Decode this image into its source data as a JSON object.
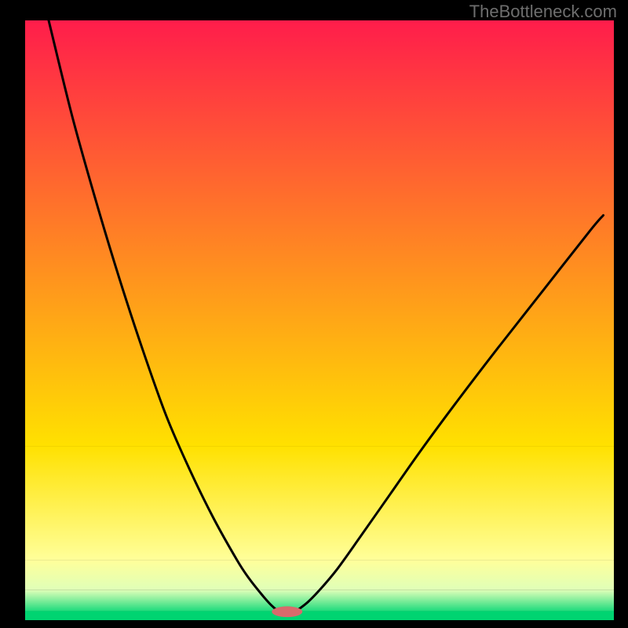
{
  "watermark": "TheBottleneck.com",
  "chart_data": {
    "type": "line",
    "title": "",
    "xlabel": "",
    "ylabel": "",
    "xlim": [
      0,
      100
    ],
    "ylim": [
      0,
      100
    ],
    "grid": false,
    "gradient_bands": [
      {
        "y0": 0.0,
        "y1": 71.0,
        "from": "#ff1d4b",
        "to": "#ffe100"
      },
      {
        "y0": 71.0,
        "y1": 90.0,
        "from": "#ffe100",
        "to": "#ffff9a"
      },
      {
        "y0": 90.0,
        "y1": 95.0,
        "from": "#ffff9a",
        "to": "#dfffb8"
      },
      {
        "y0": 95.0,
        "y1": 98.5,
        "from": "#dfffb8",
        "to": "#1edb7c"
      },
      {
        "y0": 98.5,
        "y1": 100.0,
        "color": "#00d471"
      }
    ],
    "series": [
      {
        "name": "curve-left",
        "x": [
          4,
          8,
          12,
          16,
          20,
          24,
          28,
          32,
          36,
          38,
          40,
          41.5,
          42.7
        ],
        "y": [
          0,
          16,
          30,
          43,
          55,
          66,
          75,
          83,
          90,
          93,
          95.5,
          97.2,
          98.3
        ]
      },
      {
        "name": "curve-right",
        "x": [
          46.3,
          48,
          50,
          53,
          57,
          62,
          67,
          73,
          80,
          88,
          96,
          98.2
        ],
        "y": [
          98.3,
          97,
          95,
          91.5,
          86,
          79,
          72,
          64,
          55,
          45,
          35,
          32.5
        ]
      }
    ],
    "marker": {
      "cx": 44.5,
      "cy": 98.6,
      "rx": 2.6,
      "ry": 0.9,
      "color": "#d86a6c"
    }
  }
}
